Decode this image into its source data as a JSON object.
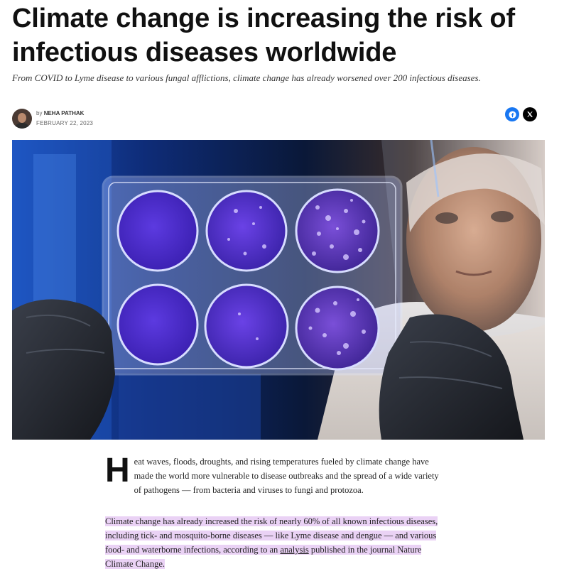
{
  "article": {
    "headline": "Climate change is increasing the risk of infectious diseases worldwide",
    "dek": "From COVID to Lyme disease to various fungal afflictions, climate change has already worsened over 200 infectious diseases.",
    "byline": {
      "prefix": "by",
      "author": "NEHA PATHAK",
      "date": "FEBRUARY 22, 2023"
    },
    "share": {
      "facebook_icon": "facebook-icon",
      "x_icon": "x-icon"
    },
    "hero": {
      "colors": {
        "bg": "#0b1a3a",
        "plate_wells": "#4a2fd0",
        "glove": "#1e2127"
      }
    },
    "body": {
      "p1_dropcap": "H",
      "p1_text": "eat waves, floods, droughts, and rising temperatures fueled by climate change have made the world more vulnerable to disease outbreaks and the spread of a wide variety of pathogens — from bacteria and viruses to fungi and protozoa.",
      "p2_before_link": "Climate change has already increased the risk of nearly 60% of all known infectious diseases, including tick- and mosquito-borne diseases — like Lyme disease and dengue — and various food- and waterborne infections, according to an ",
      "p2_link": "analysis",
      "p2_after_link": " published in the journal Nature Climate Change.",
      "highlight_color": "#ead2f5"
    }
  }
}
